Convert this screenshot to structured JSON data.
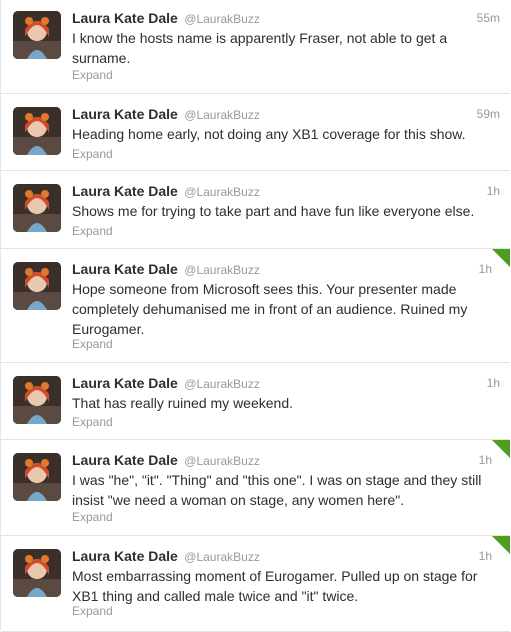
{
  "tweets": [
    {
      "fullname": "Laura Kate Dale",
      "username": "@LaurakBuzz",
      "time": "55m",
      "text": "I know the hosts name is apparently Fraser, not able to get a surname.",
      "expand_label": "Expand",
      "favorited": false
    },
    {
      "fullname": "Laura Kate Dale",
      "username": "@LaurakBuzz",
      "time": "59m",
      "text": "Heading home early, not doing any XB1 coverage for this show.",
      "expand_label": "Expand",
      "favorited": false
    },
    {
      "fullname": "Laura Kate Dale",
      "username": "@LaurakBuzz",
      "time": "1h",
      "text": "Shows me for trying to take part and have fun like everyone else.",
      "expand_label": "Expand",
      "favorited": false
    },
    {
      "fullname": "Laura Kate Dale",
      "username": "@LaurakBuzz",
      "time": "1h",
      "text": "Hope someone from Microsoft sees this. Your presenter made completely dehumanised me in front of an audience. Ruined my Eurogamer.",
      "expand_label": "Expand",
      "favorited": true
    },
    {
      "fullname": "Laura Kate Dale",
      "username": "@LaurakBuzz",
      "time": "1h",
      "text": "That has really ruined my weekend.",
      "expand_label": "Expand",
      "favorited": false
    },
    {
      "fullname": "Laura Kate Dale",
      "username": "@LaurakBuzz",
      "time": "1h",
      "text": "I was \"he\", \"it\". \"Thing\" and \"this one\". I was on stage and they still insist \"we need a woman on stage, any women here\".",
      "expand_label": "Expand",
      "favorited": true
    },
    {
      "fullname": "Laura Kate Dale",
      "username": "@LaurakBuzz",
      "time": "1h",
      "text": "Most embarrassing moment of Eurogamer. Pulled up on stage for XB1 thing and called male twice and \"it\" twice.",
      "expand_label": "Expand",
      "favorited": true
    }
  ],
  "colors": {
    "favorite_flag": "#4c9e1f",
    "meta_text": "#999999",
    "divider": "#e3e3e3"
  }
}
